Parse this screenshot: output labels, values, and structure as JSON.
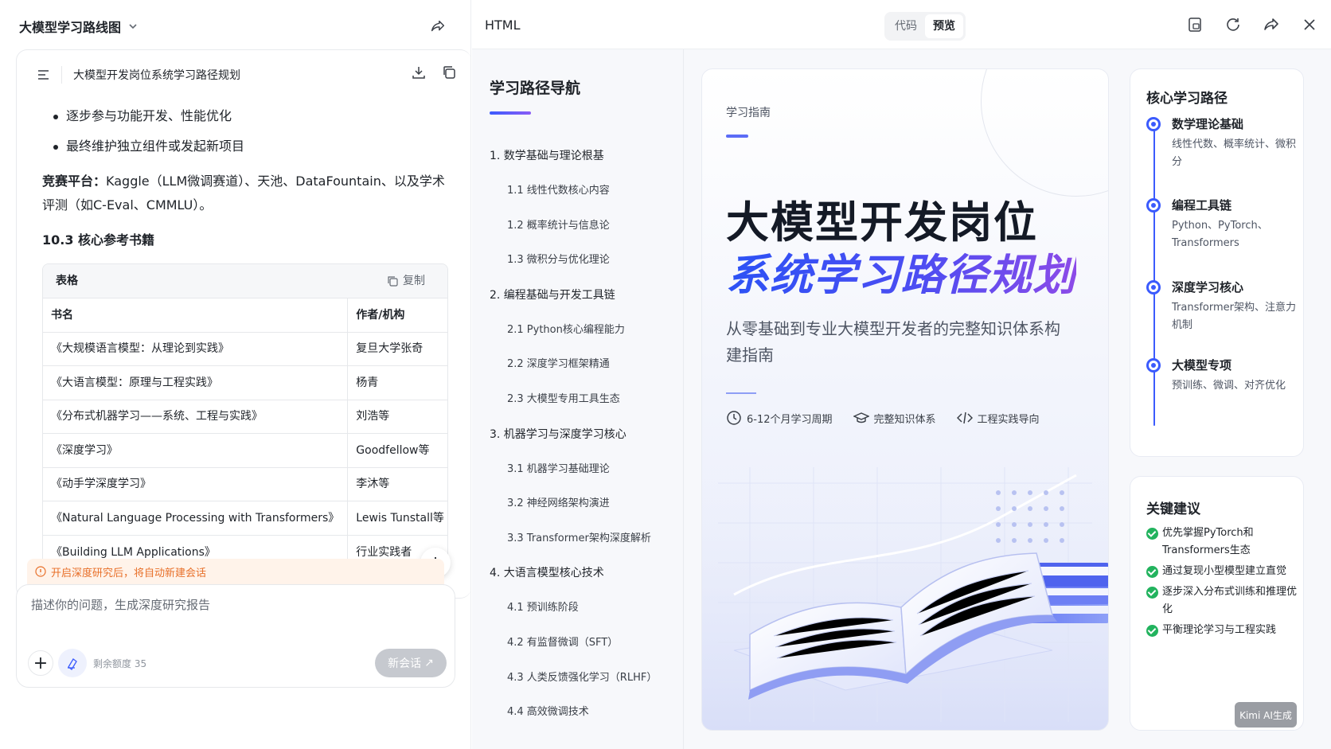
{
  "left": {
    "title": "大模型学习路线图",
    "doc_title": "大模型开发岗位系统学习路径规划",
    "bullets": [
      "逐步参与功能开发、性能优化",
      "最终维护独立组件或发起新项目"
    ],
    "competition_label": "竞赛平台：",
    "competition_text": "Kaggle（LLM微调赛道）、天池、DataFountain、以及学术评测（如C-Eval、CMMLU）。",
    "section_heading": "10.3 核心参考书籍",
    "table": {
      "label": "表格",
      "copy_label": "复制",
      "headers": [
        "书名",
        "作者/机构"
      ],
      "rows": [
        [
          "《大规模语言模型：从理论到实践》",
          "复旦大学张奇"
        ],
        [
          "《大语言模型：原理与工程实践》",
          "杨青"
        ],
        [
          "《分布式机器学习——系统、工程与实践》",
          "刘浩等"
        ],
        [
          "《深度学习》",
          "Goodfellow等"
        ],
        [
          "《动手学深度学习》",
          "李沐等"
        ],
        [
          "《Natural Language Processing with Transformers》",
          "Lewis Tunstall等"
        ],
        [
          "《Building LLM Applications》",
          "行业实践者"
        ]
      ]
    },
    "notice": "开启深度研究后，将自动新建会话",
    "input_placeholder": "描述你的问题，生成深度研究报告",
    "quota": "剩余额度 35",
    "new_chat": "新会话"
  },
  "right": {
    "label": "HTML",
    "tabs": [
      "代码",
      "预览"
    ],
    "active_tab": "预览",
    "nav": {
      "title": "学习路径导航",
      "items": [
        {
          "label": "1. 数学基础与理论根基",
          "subs": [
            "1.1 线性代数核心内容",
            "1.2 概率统计与信息论",
            "1.3 微积分与优化理论"
          ]
        },
        {
          "label": "2. 编程基础与开发工具链",
          "subs": [
            "2.1 Python核心编程能力",
            "2.2 深度学习框架精通",
            "2.3 大模型专用工具生态"
          ]
        },
        {
          "label": "3. 机器学习与深度学习核心",
          "subs": [
            "3.1 机器学习基础理论",
            "3.2 神经网络架构演进",
            "3.3 Transformer架构深度解析"
          ]
        },
        {
          "label": "4. 大语言模型核心技术",
          "subs": [
            "4.1 预训练阶段",
            "4.2 有监督微调（SFT）",
            "4.3 人类反馈强化学习（RLHF）",
            "4.4 高效微调技术"
          ]
        }
      ]
    },
    "hero": {
      "tag": "学习指南",
      "title_line1": "大模型开发岗位",
      "title_line2": "系统学习路径规划",
      "subtitle": "从零基础到专业大模型开发者的完整知识体系构建指南",
      "meta": [
        "6-12个月学习周期",
        "完整知识体系",
        "工程实践导向"
      ]
    },
    "core_path": {
      "title": "核心学习路径",
      "items": [
        {
          "head": "数学理论基础",
          "desc": "线性代数、概率统计、微积分"
        },
        {
          "head": "编程工具链",
          "desc": "Python、PyTorch、Transformers"
        },
        {
          "head": "深度学习核心",
          "desc": "Transformer架构、注意力机制"
        },
        {
          "head": "大模型专项",
          "desc": "预训练、微调、对齐优化"
        }
      ]
    },
    "tips": {
      "title": "关键建议",
      "items": [
        "优先掌握PyTorch和Transformers生态",
        "通过复现小型模型建立直觉",
        "逐步深入分布式训练和推理优化",
        "平衡理论学习与工程实践"
      ]
    },
    "badge": "Kimi AI生成"
  },
  "colors": {
    "accent": "#3b5bfd",
    "accent_purple": "#8a5cf6",
    "notice_orange": "#e8702a",
    "check_green": "#22b35e"
  }
}
